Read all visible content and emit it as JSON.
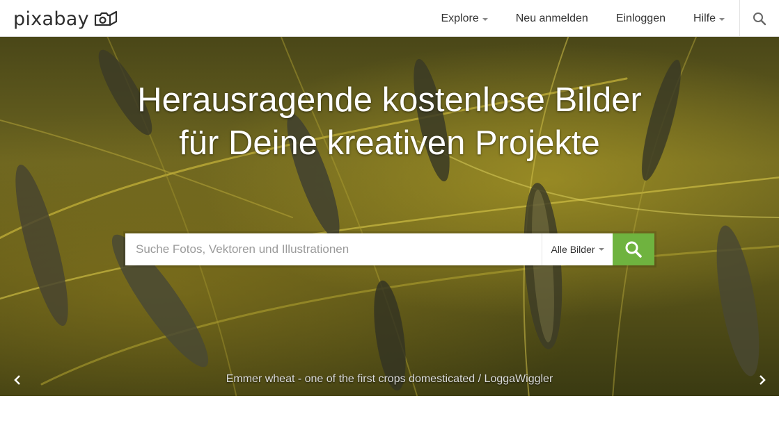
{
  "header": {
    "logo_text": "pixabay",
    "nav": {
      "explore": "Explore",
      "register": "Neu anmelden",
      "login": "Einloggen",
      "help": "Hilfe"
    }
  },
  "hero": {
    "headline_line1": "Herausragende kostenlose Bilder",
    "headline_line2": "für Deine kreativen Projekte",
    "search": {
      "placeholder": "Suche Fotos, Vektoren und Illustrationen",
      "value": "",
      "type_selected": "Alle Bilder"
    },
    "caption": "Emmer wheat - one of the first crops domesticated / LoggaWiggler"
  },
  "colors": {
    "accent": "#6fb33f",
    "text": "#333333",
    "header_bg": "#ffffff"
  },
  "icons": {
    "logo": "camera-icon",
    "nav_search": "search-icon",
    "search_button": "search-icon",
    "prev": "chevron-left-icon",
    "next": "chevron-right-icon"
  }
}
